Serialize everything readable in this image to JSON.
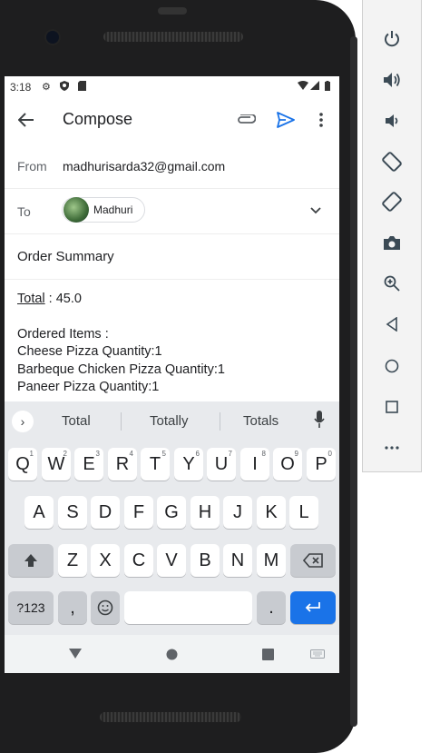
{
  "status_bar": {
    "time": "3:18"
  },
  "app_bar": {
    "title": "Compose"
  },
  "from": {
    "label": "From",
    "value": "madhurisarda32@gmail.com"
  },
  "to": {
    "label": "To",
    "chip_name": "Madhuri"
  },
  "subject": {
    "value": "Order Summary"
  },
  "body": {
    "total_label": "Total",
    "total_value": " : 45.0",
    "ordered_heading": "Ordered Items :",
    "items": [
      "Cheese Pizza Quantity:1",
      "Barbeque Chicken Pizza Quantity:1",
      "Paneer Pizza Quantity:1"
    ]
  },
  "keyboard": {
    "suggestions": [
      "Total",
      "Totally",
      "Totals"
    ],
    "row1": [
      "Q",
      "W",
      "E",
      "R",
      "T",
      "Y",
      "U",
      "I",
      "O",
      "P"
    ],
    "row1_hints": [
      "1",
      "2",
      "3",
      "4",
      "5",
      "6",
      "7",
      "8",
      "9",
      "0"
    ],
    "row2": [
      "A",
      "S",
      "D",
      "F",
      "G",
      "H",
      "J",
      "K",
      "L"
    ],
    "row3": [
      "Z",
      "X",
      "C",
      "V",
      "B",
      "N",
      "M"
    ],
    "symbols_label": "?123",
    "comma": ",",
    "period": "."
  },
  "colors": {
    "accent": "#1a73e8",
    "keyboard_bg": "#e8eaed",
    "phone_frame": "#1e1e1f"
  },
  "emulator_panel": {
    "icons": [
      "power-icon",
      "volume-up-icon",
      "volume-down-icon",
      "rotate-left-icon",
      "rotate-right-icon",
      "camera-icon",
      "zoom-icon",
      "back-icon",
      "home-icon",
      "overview-icon",
      "more-icon"
    ],
    "window_controls": {
      "minimize": "−",
      "close": "×"
    }
  }
}
